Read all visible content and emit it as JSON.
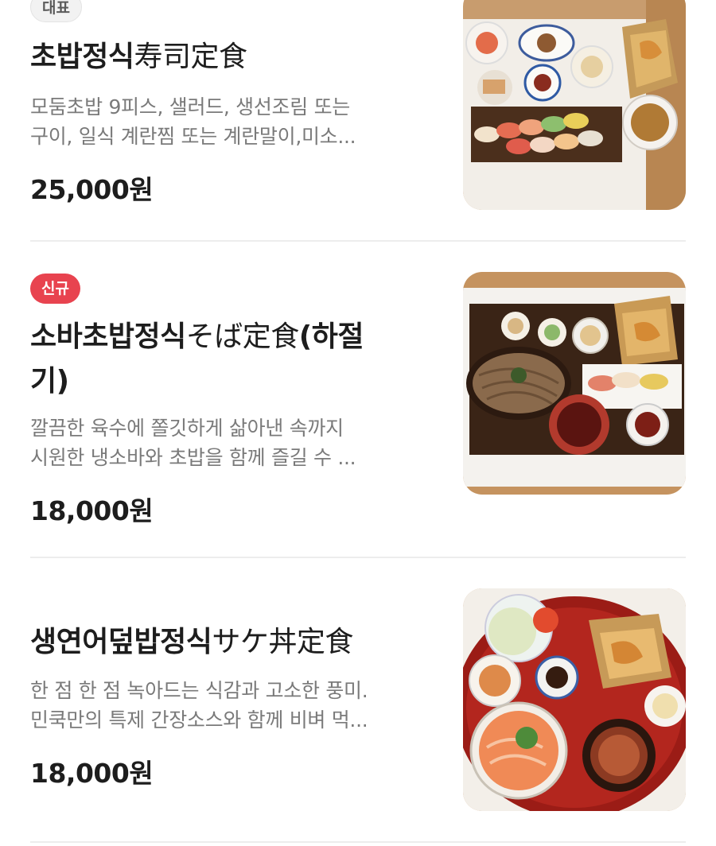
{
  "menu": {
    "items": [
      {
        "badge": "대표",
        "title_ko": "초밥정식",
        "title_ja": "寿司定食",
        "desc_line1": "모둠초밥 9피스, 샐러드, 생선조림 또는",
        "desc_line2": "구이, 일식 계란찜 또는 계란말이,미소...",
        "price": "25,000원",
        "image_icon": "sushi-set-photo"
      },
      {
        "badge": "신규",
        "title_ko": "소바초밥정식",
        "title_ja": "そば定食",
        "title_suffix": "(하절",
        "title_line2": "기)",
        "desc_line1": "깔끔한 육수에 쫄깃하게 삶아낸 속까지",
        "desc_line2": "시원한 냉소바와 초밥을 함께 즐길 수 ...",
        "price": "18,000원",
        "image_icon": "soba-set-photo"
      },
      {
        "title_ko": "생연어덮밥정식",
        "title_ja": "サケ丼定食",
        "desc_line1": "한 점 한 점 녹아드는 식감과 고소한 풍미.",
        "desc_line2": "민쿡만의 특제 간장소스와 함께 비벼 먹...",
        "price": "18,000원",
        "image_icon": "salmon-bowl-set-photo"
      }
    ]
  },
  "colors": {
    "badge_new": "#e8434f",
    "badge_rep": "#f2f2f2",
    "price_text": "#1d1d1d",
    "desc_text": "#7a7a7a"
  }
}
